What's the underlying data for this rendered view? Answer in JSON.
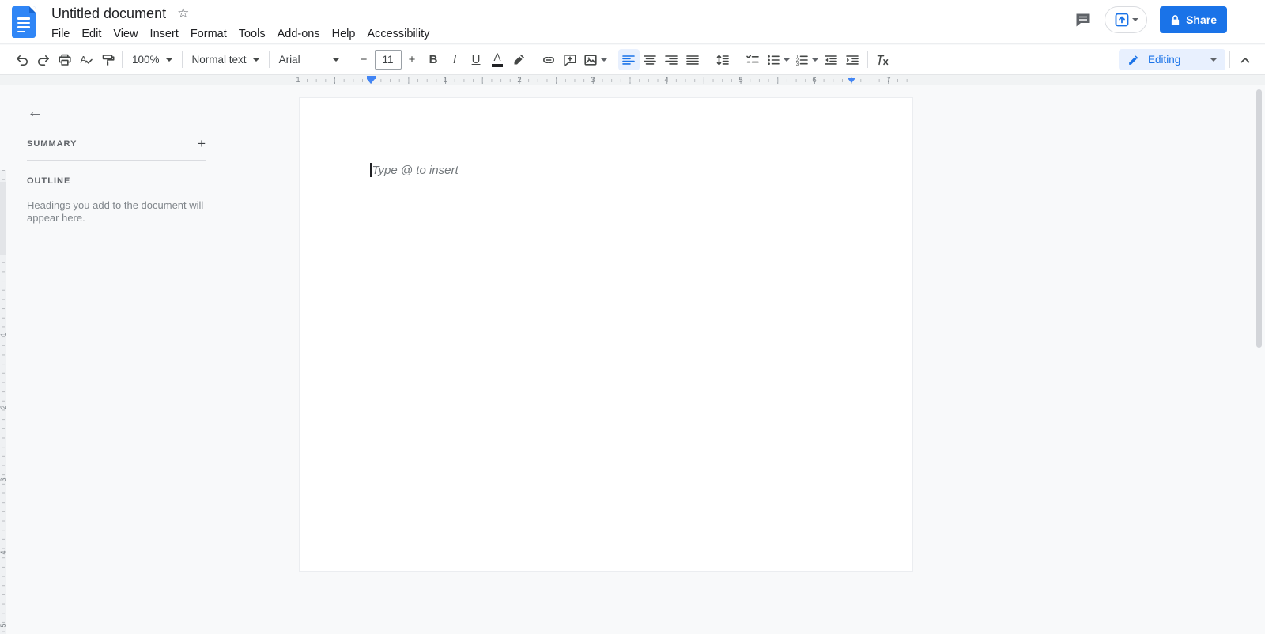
{
  "header": {
    "title": "Untitled document",
    "menus": [
      "File",
      "Edit",
      "View",
      "Insert",
      "Format",
      "Tools",
      "Add-ons",
      "Help",
      "Accessibility"
    ],
    "share_label": "Share"
  },
  "toolbar": {
    "zoom_value": "100%",
    "styles_value": "Normal text",
    "font_value": "Arial",
    "font_size_value": "11",
    "bold_glyph": "B",
    "italic_glyph": "I",
    "underline_glyph": "U",
    "text_color_glyph": "A",
    "mode_label": "Editing"
  },
  "ruler": {
    "h_labels": [
      "1",
      "1",
      "2",
      "3",
      "4",
      "5",
      "6",
      "7"
    ],
    "v_labels": [
      "1",
      "2",
      "3",
      "4",
      "5"
    ]
  },
  "sidebar": {
    "summary_label": "SUMMARY",
    "outline_label": "OUTLINE",
    "outline_empty_text": "Headings you add to the document will appear here."
  },
  "document": {
    "placeholder": "Type @ to insert"
  },
  "icons": {
    "star": "☆",
    "back_arrow": "←",
    "plus": "+",
    "minus": "−"
  },
  "colors": {
    "accent_blue": "#1a73e8",
    "docs_logo_blue": "#3086f6",
    "active_background": "#e8f0fe",
    "canvas_background": "#f8f9fa",
    "indent_marker_blue": "#4285f4"
  }
}
